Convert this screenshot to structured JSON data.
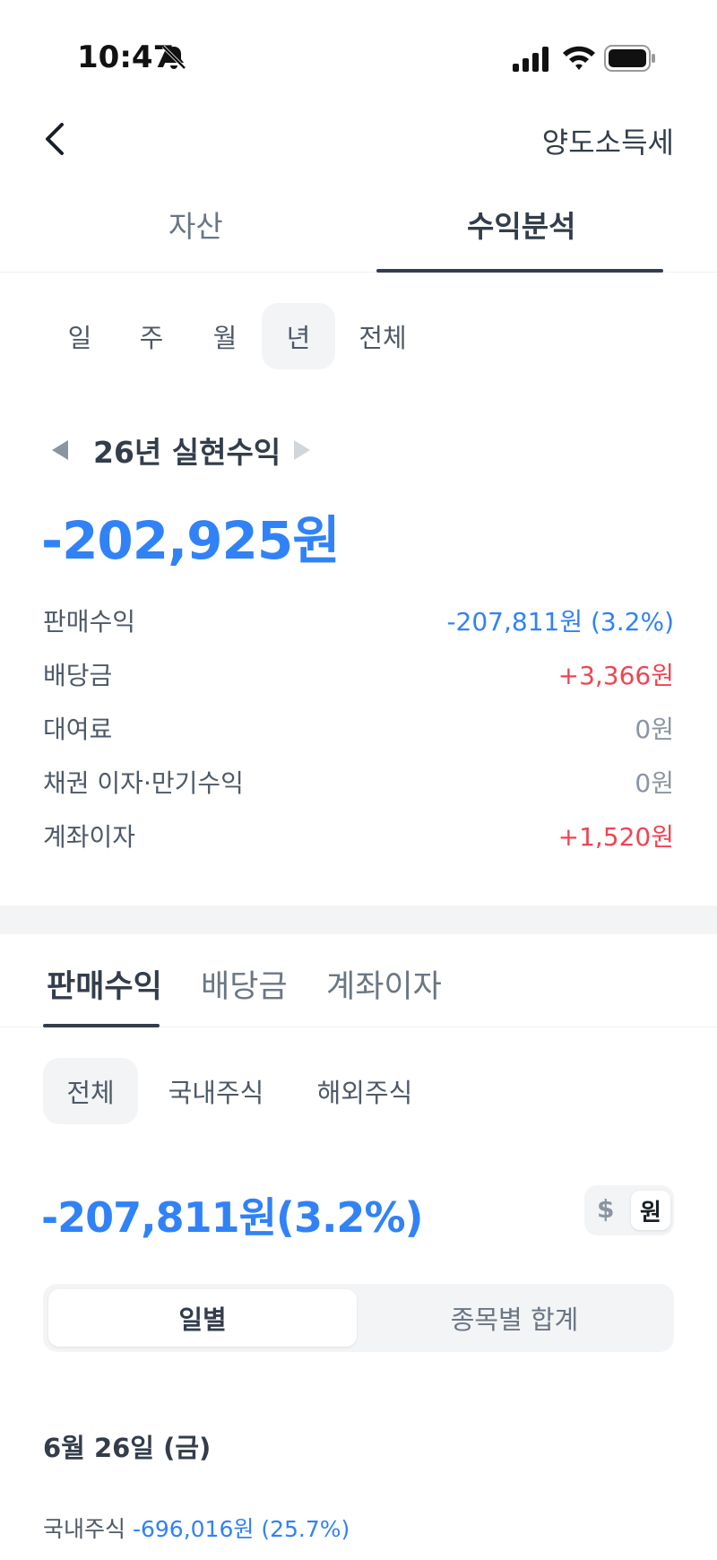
{
  "status_bar": {
    "time": "10:47"
  },
  "icons": {
    "bell": "bell-slash-icon",
    "signal": "cellular-signal-icon",
    "wifi": "wifi-icon",
    "battery": "battery-icon",
    "back": "chevron-left-icon",
    "prev": "triangle-left-icon",
    "next": "triangle-right-icon"
  },
  "header": {
    "action_label": "양도소득세"
  },
  "top_tabs": [
    {
      "label": "자산"
    },
    {
      "label": "수익분석"
    }
  ],
  "period_chips": [
    {
      "label": "일"
    },
    {
      "label": "주"
    },
    {
      "label": "월"
    },
    {
      "label": "년"
    },
    {
      "label": "전체"
    }
  ],
  "summary": {
    "title": "26년 실현수익",
    "total": "-202,925원",
    "rows": [
      {
        "label": "판매수익",
        "value": "-207,811원 (3.2%)"
      },
      {
        "label": "배당금",
        "value": "+3,366원"
      },
      {
        "label": "대여료",
        "value": "0원"
      },
      {
        "label": "채권 이자·만기수익",
        "value": "0원"
      },
      {
        "label": "계좌이자",
        "value": "+1,520원"
      }
    ]
  },
  "sub_tabs": [
    {
      "label": "판매수익"
    },
    {
      "label": "배당금"
    },
    {
      "label": "계좌이자"
    }
  ],
  "market_chips": [
    {
      "label": "전체"
    },
    {
      "label": "국내주식"
    },
    {
      "label": "해외주식"
    }
  ],
  "sale": {
    "total": "-207,811원(3.2%)",
    "currency_usd": "$",
    "currency_krw": "원"
  },
  "segment": {
    "daily": "일별",
    "by_stock": "종목별 합계"
  },
  "daily_list": {
    "date": "6월 26일 (금)",
    "item_label": "국내주식",
    "item_value": "-696,016원 (25.7%)"
  },
  "colors": {
    "accent_blue": "#3182f6",
    "accent_red": "#f04452",
    "text_primary": "#333d4b",
    "chip_bg": "#f2f4f6"
  }
}
